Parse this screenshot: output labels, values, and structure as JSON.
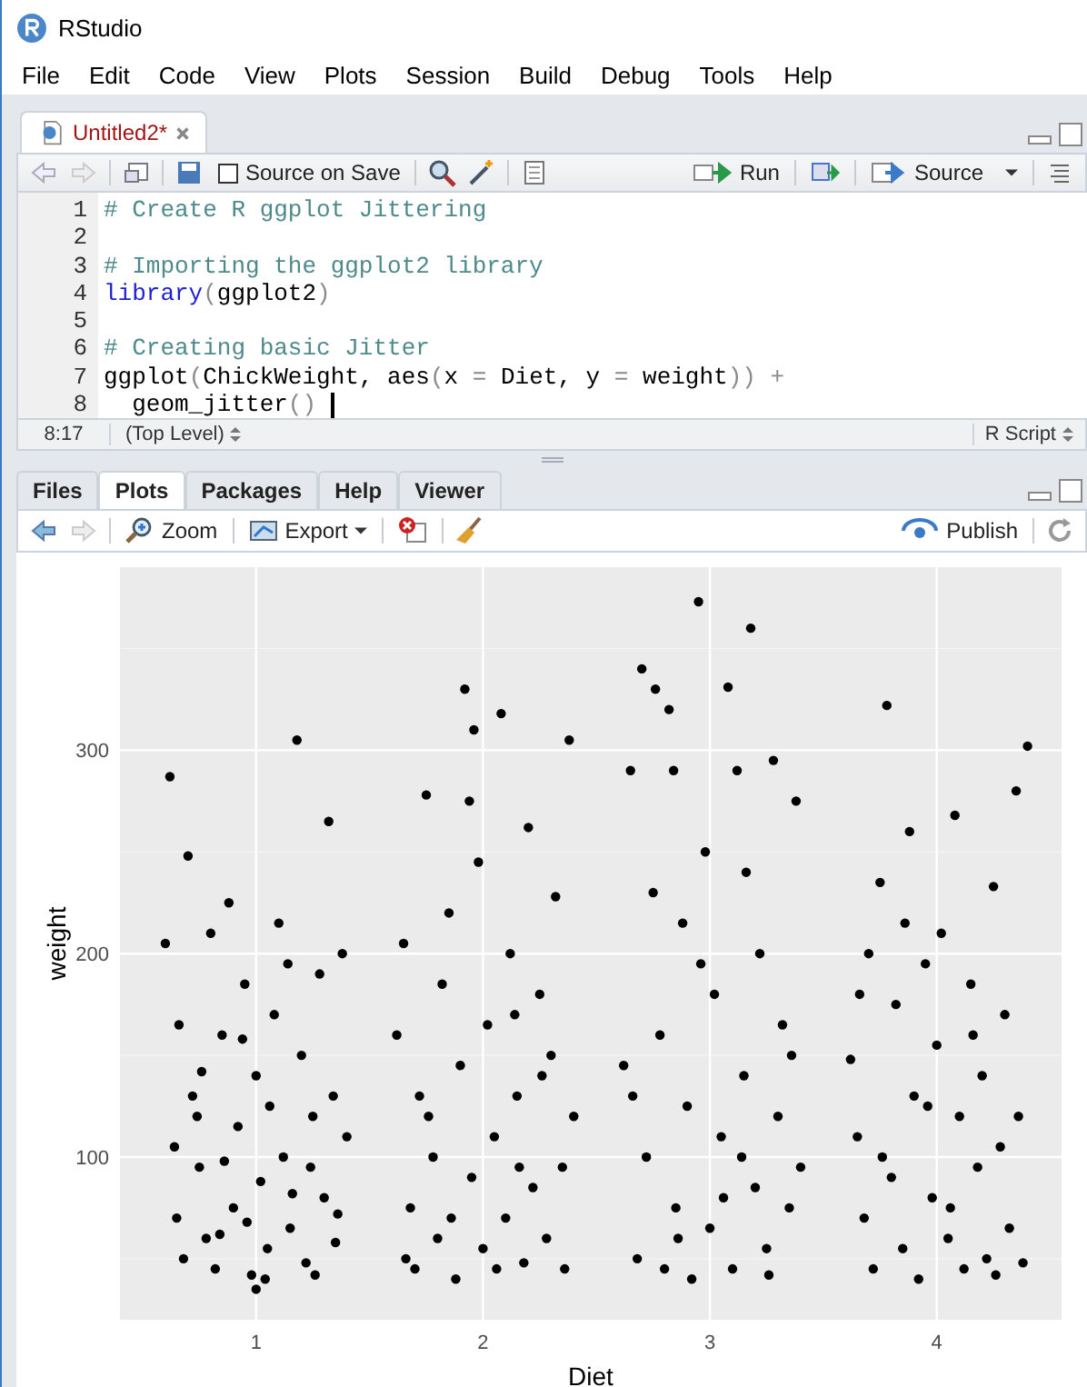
{
  "window": {
    "title": "RStudio"
  },
  "menu": [
    "File",
    "Edit",
    "Code",
    "View",
    "Plots",
    "Session",
    "Build",
    "Debug",
    "Tools",
    "Help"
  ],
  "editor": {
    "tabs": [
      {
        "label": "Untitled2*",
        "selected": true
      }
    ],
    "toolbar": {
      "source_on_save": {
        "label": "Source on Save",
        "checked": false
      },
      "run": "Run",
      "source": "Source"
    },
    "lines": [
      {
        "number": "1",
        "segments": [
          {
            "kind": "comment",
            "text": "# Create R ggplot Jittering"
          }
        ]
      },
      {
        "number": "2"
      },
      {
        "number": "3",
        "segments": [
          {
            "kind": "comment",
            "text": "# Importing the ggplot2 library"
          }
        ]
      },
      {
        "number": "4",
        "segments": [
          {
            "kind": "function",
            "text": "library"
          },
          {
            "kind": "punct",
            "text": "("
          },
          {
            "kind": "plain",
            "text": "ggplot2"
          },
          {
            "kind": "punct",
            "text": ")"
          }
        ]
      },
      {
        "number": "5"
      },
      {
        "number": "6",
        "segments": [
          {
            "kind": "comment",
            "text": "# Creating basic Jitter"
          }
        ]
      },
      {
        "number": "7",
        "segments": [
          {
            "kind": "plain",
            "text": "ggplot"
          },
          {
            "kind": "punct",
            "text": "("
          },
          {
            "kind": "plain",
            "text": "ChickWeight, aes"
          },
          {
            "kind": "punct",
            "text": "("
          },
          {
            "kind": "plain",
            "text": "x "
          },
          {
            "kind": "punct",
            "text": "="
          },
          {
            "kind": "plain",
            "text": " Diet, y "
          },
          {
            "kind": "punct",
            "text": "="
          },
          {
            "kind": "plain",
            "text": " weight"
          },
          {
            "kind": "punct",
            "text": "))"
          },
          {
            "kind": "punct",
            "text": " +"
          }
        ]
      },
      {
        "number": "8",
        "cursor": true,
        "segments": [
          {
            "kind": "plain",
            "text": "  geom_jitter"
          },
          {
            "kind": "punct",
            "text": "()"
          }
        ]
      }
    ],
    "status": {
      "position": "8:17",
      "scope": "(Top Level)",
      "filetype": "R Script"
    }
  },
  "plots_pane": {
    "tabs": [
      {
        "label": "Files",
        "selected": false
      },
      {
        "label": "Plots",
        "selected": true
      },
      {
        "label": "Packages",
        "selected": false
      },
      {
        "label": "Help",
        "selected": false
      },
      {
        "label": "Viewer",
        "selected": false
      }
    ],
    "toolbar": {
      "zoom": "Zoom",
      "export": "Export",
      "publish": "Publish"
    },
    "chart_data": {
      "type": "scatter",
      "grid": true,
      "xlabel": "Diet",
      "ylabel": "weight",
      "xlim": [
        0.4,
        4.55
      ],
      "ylim": [
        20,
        390
      ],
      "xticks": [
        {
          "value": 1,
          "label": "1"
        },
        {
          "value": 2,
          "label": "2"
        },
        {
          "value": 3,
          "label": "3"
        },
        {
          "value": 4,
          "label": "4"
        }
      ],
      "yticks": [
        100,
        200,
        300
      ],
      "x": [
        0.62,
        0.6,
        0.66,
        0.7,
        0.72,
        0.75,
        0.78,
        0.8,
        0.82,
        0.85,
        0.88,
        0.9,
        0.92,
        0.95,
        0.98,
        1.0,
        1.02,
        1.05,
        1.08,
        1.1,
        1.12,
        1.15,
        1.18,
        1.2,
        1.22,
        1.25,
        1.28,
        1.3,
        1.32,
        1.35,
        1.38,
        1.4,
        0.65,
        0.68,
        0.74,
        0.86,
        0.96,
        1.06,
        1.16,
        1.26,
        1.36,
        0.64,
        0.84,
        1.04,
        1.24,
        0.94,
        1.14,
        0.76,
        1.34,
        1.0,
        1.62,
        1.65,
        1.68,
        1.7,
        1.72,
        1.75,
        1.78,
        1.8,
        1.82,
        1.85,
        1.88,
        1.9,
        1.92,
        1.95,
        1.98,
        2.0,
        2.02,
        2.05,
        2.08,
        2.1,
        2.12,
        2.15,
        2.18,
        2.2,
        2.22,
        2.25,
        2.28,
        2.3,
        2.32,
        2.35,
        2.38,
        2.4,
        1.66,
        1.76,
        1.86,
        1.96,
        2.06,
        2.16,
        2.26,
        2.36,
        1.94,
        2.14,
        2.62,
        2.65,
        2.68,
        2.7,
        2.72,
        2.75,
        2.78,
        2.8,
        2.82,
        2.85,
        2.88,
        2.9,
        2.92,
        2.95,
        2.98,
        3.0,
        3.02,
        3.05,
        3.08,
        3.1,
        3.12,
        3.15,
        3.18,
        3.2,
        3.22,
        3.25,
        3.28,
        3.3,
        3.32,
        3.35,
        3.38,
        3.4,
        2.66,
        2.76,
        2.86,
        2.96,
        3.06,
        3.16,
        3.26,
        3.36,
        2.84,
        3.14,
        3.62,
        3.65,
        3.68,
        3.7,
        3.72,
        3.75,
        3.78,
        3.8,
        3.82,
        3.85,
        3.88,
        3.9,
        3.92,
        3.95,
        3.98,
        4.0,
        4.02,
        4.05,
        4.08,
        4.1,
        4.12,
        4.15,
        4.18,
        4.2,
        4.22,
        4.25,
        4.28,
        4.3,
        4.32,
        4.35,
        4.38,
        4.4,
        3.66,
        3.76,
        3.86,
        3.96,
        4.06,
        4.16,
        4.26,
        4.36
      ],
      "series": [
        {
          "values": [
            287,
            205,
            165,
            248,
            130,
            95,
            60,
            210,
            45,
            160,
            225,
            75,
            115,
            185,
            42,
            140,
            88,
            55,
            170,
            215,
            100,
            65,
            305,
            150,
            48,
            120,
            190,
            80,
            265,
            58,
            200,
            110,
            70,
            50,
            120,
            98,
            68,
            125,
            82,
            42,
            72,
            105,
            62,
            40,
            95,
            158,
            195,
            142,
            130,
            35,
            160,
            205,
            75,
            45,
            130,
            278,
            100,
            60,
            185,
            220,
            40,
            145,
            330,
            90,
            245,
            55,
            165,
            110,
            318,
            70,
            200,
            130,
            48,
            262,
            85,
            180,
            60,
            150,
            228,
            95,
            305,
            120,
            50,
            120,
            70,
            310,
            45,
            95,
            140,
            45,
            275,
            170,
            145,
            290,
            50,
            340,
            100,
            230,
            160,
            45,
            320,
            75,
            215,
            125,
            40,
            373,
            250,
            65,
            180,
            110,
            331,
            45,
            290,
            140,
            360,
            85,
            200,
            55,
            295,
            120,
            165,
            75,
            275,
            95,
            130,
            330,
            60,
            195,
            80,
            240,
            42,
            150,
            290,
            100,
            148,
            110,
            70,
            200,
            45,
            235,
            322,
            90,
            175,
            55,
            260,
            130,
            40,
            195,
            80,
            155,
            210,
            60,
            268,
            120,
            45,
            185,
            95,
            140,
            50,
            233,
            105,
            170,
            65,
            280,
            48,
            302,
            180,
            100,
            215,
            125,
            75,
            160,
            42,
            120
          ]
        }
      ]
    }
  }
}
